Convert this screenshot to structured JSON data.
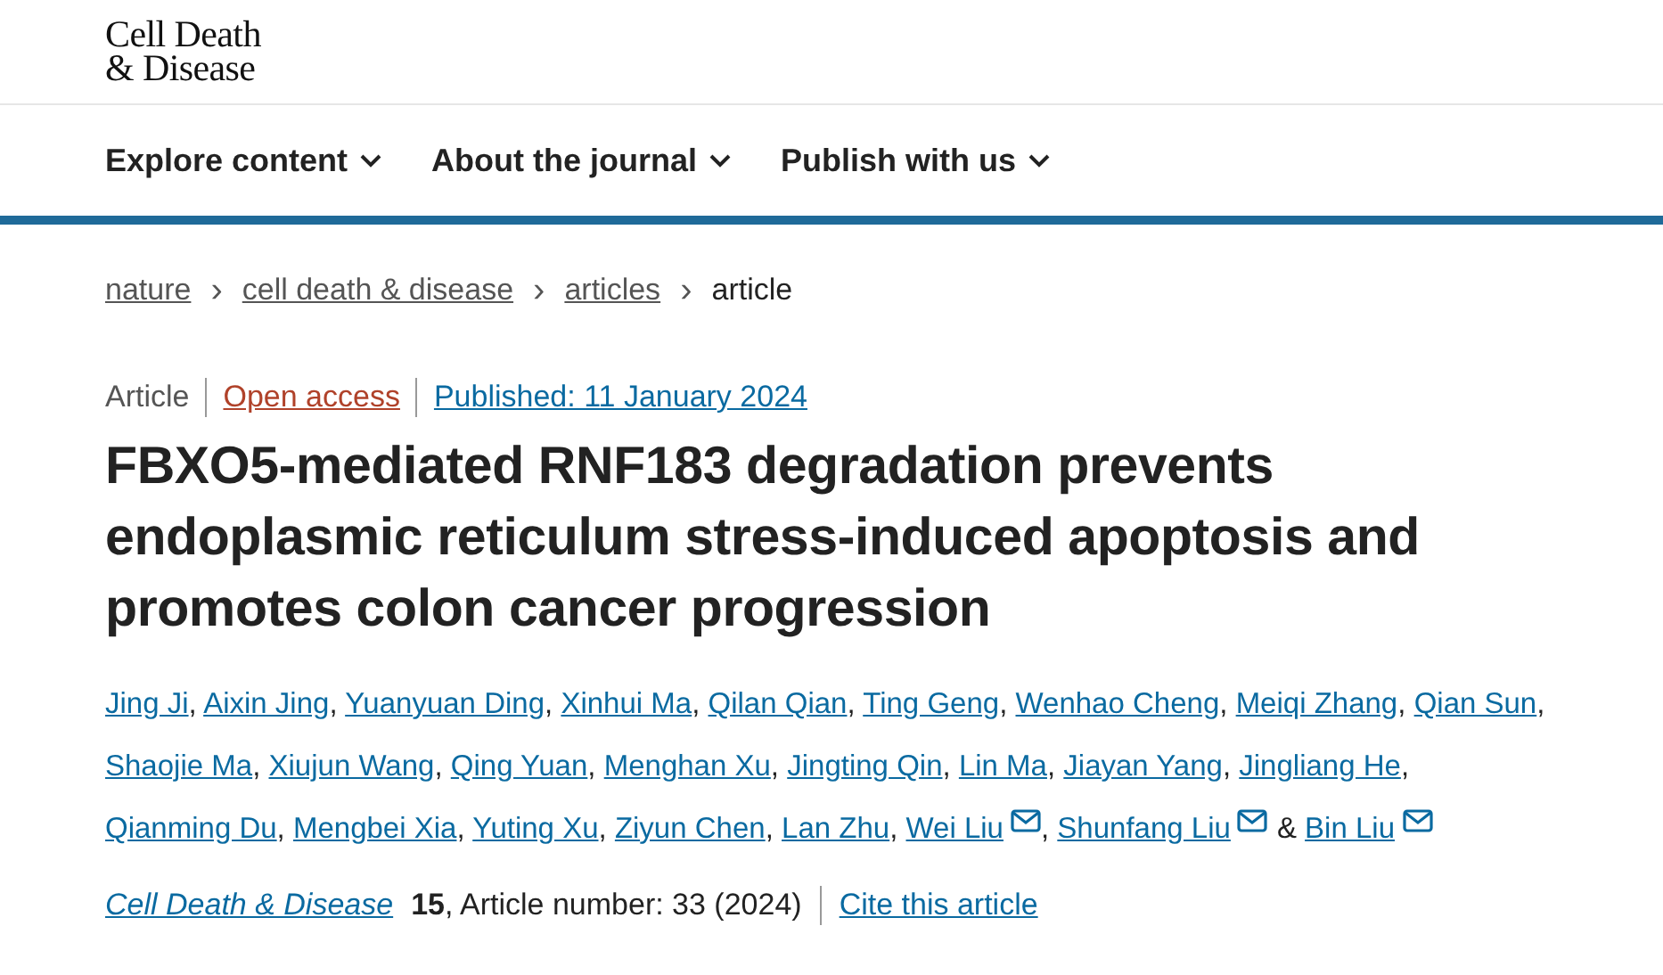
{
  "logo": {
    "line_1": "Cell Death",
    "line_2": "& Disease"
  },
  "nav": [
    {
      "label": "Explore content"
    },
    {
      "label": "About the journal"
    },
    {
      "label": "Publish with us"
    }
  ],
  "breadcrumbs": [
    {
      "label": "nature",
      "current": false
    },
    {
      "label": "cell death & disease",
      "current": false
    },
    {
      "label": "articles",
      "current": false
    },
    {
      "label": "article",
      "current": true
    }
  ],
  "breadcrumb_separator": "›",
  "meta": {
    "type": "Article",
    "access": "Open access",
    "published": "Published: 11 January 2024"
  },
  "title": "FBXO5-mediated RNF183 degradation prevents endoplasmic reticulum stress-induced apoptosis and promotes colon cancer progression",
  "authors": [
    {
      "name": "Jing Ji",
      "email": false,
      "separator": ","
    },
    {
      "name": "Aixin Jing",
      "email": false,
      "separator": ","
    },
    {
      "name": "Yuanyuan Ding",
      "email": false,
      "separator": ","
    },
    {
      "name": "Xinhui Ma",
      "email": false,
      "separator": ","
    },
    {
      "name": "Qilan Qian",
      "email": false,
      "separator": ","
    },
    {
      "name": "Ting Geng",
      "email": false,
      "separator": ","
    },
    {
      "name": "Wenhao Cheng",
      "email": false,
      "separator": ","
    },
    {
      "name": "Meiqi Zhang",
      "email": false,
      "separator": ","
    },
    {
      "name": "Qian Sun",
      "email": false,
      "separator": ","
    },
    {
      "name": "Shaojie Ma",
      "email": false,
      "separator": ","
    },
    {
      "name": "Xiujun Wang",
      "email": false,
      "separator": ","
    },
    {
      "name": "Qing Yuan",
      "email": false,
      "separator": ","
    },
    {
      "name": "Menghan Xu",
      "email": false,
      "separator": ","
    },
    {
      "name": "Jingting Qin",
      "email": false,
      "separator": ","
    },
    {
      "name": "Lin Ma",
      "email": false,
      "separator": ","
    },
    {
      "name": "Jiayan Yang",
      "email": false,
      "separator": ","
    },
    {
      "name": "Jingliang He",
      "email": false,
      "separator": ","
    },
    {
      "name": "Qianming Du",
      "email": false,
      "separator": ","
    },
    {
      "name": "Mengbei Xia",
      "email": false,
      "separator": ","
    },
    {
      "name": "Yuting Xu",
      "email": false,
      "separator": ","
    },
    {
      "name": "Ziyun Chen",
      "email": false,
      "separator": ","
    },
    {
      "name": "Lan Zhu",
      "email": false,
      "separator": ","
    },
    {
      "name": "Wei Liu",
      "email": true,
      "separator": ","
    },
    {
      "name": "Shunfang Liu",
      "email": true,
      "separator": "&"
    },
    {
      "name": "Bin Liu",
      "email": true
    }
  ],
  "citation": {
    "journal": "Cell Death & Disease",
    "volume": "15",
    "details": ", Article number: 33 (2024)",
    "cite_link": "Cite this article"
  }
}
